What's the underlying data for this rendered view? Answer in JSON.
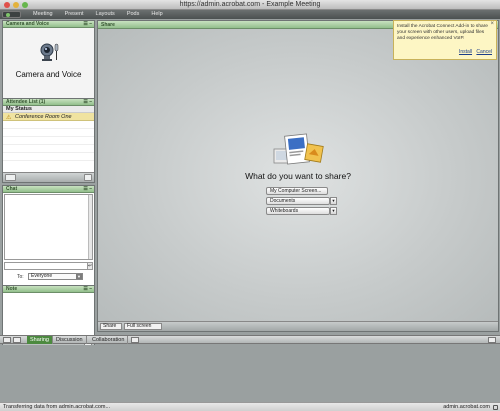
{
  "window": {
    "title": "https://admin.acrobat.com - Example Meeting"
  },
  "menu": {
    "items": [
      "Meeting",
      "Present",
      "Layouts",
      "Pods",
      "Help"
    ]
  },
  "camera_pod": {
    "title": "Camera and Voice",
    "body_label": "Camera and Voice"
  },
  "attendee_pod": {
    "title": "Attendee List (1)",
    "section": "My Status",
    "attendee": "Conference Room One"
  },
  "chat_pod": {
    "title": "Chat",
    "to_label": "To:",
    "to_value": "Everyone"
  },
  "note_pod": {
    "title": "Note"
  },
  "share_pod": {
    "title": "Share",
    "question": "What do you want to share?",
    "options": [
      "My Computer Screen...",
      "Documents",
      "Whiteboards"
    ],
    "footer_share": "Share",
    "footer_fullscreen": "Full screen"
  },
  "notice": {
    "text": "Install the Acrobat Connect Add-in to share your screen with other users, upload files and experience enhanced VoIP.",
    "install": "Install",
    "cancel": "Cancel"
  },
  "layout_tabs": [
    "Sharing",
    "Discussion",
    "Collaboration"
  ],
  "status": {
    "left": "Transferring data from admin.acrobat.com...",
    "right": "admin.acrobat.com"
  }
}
